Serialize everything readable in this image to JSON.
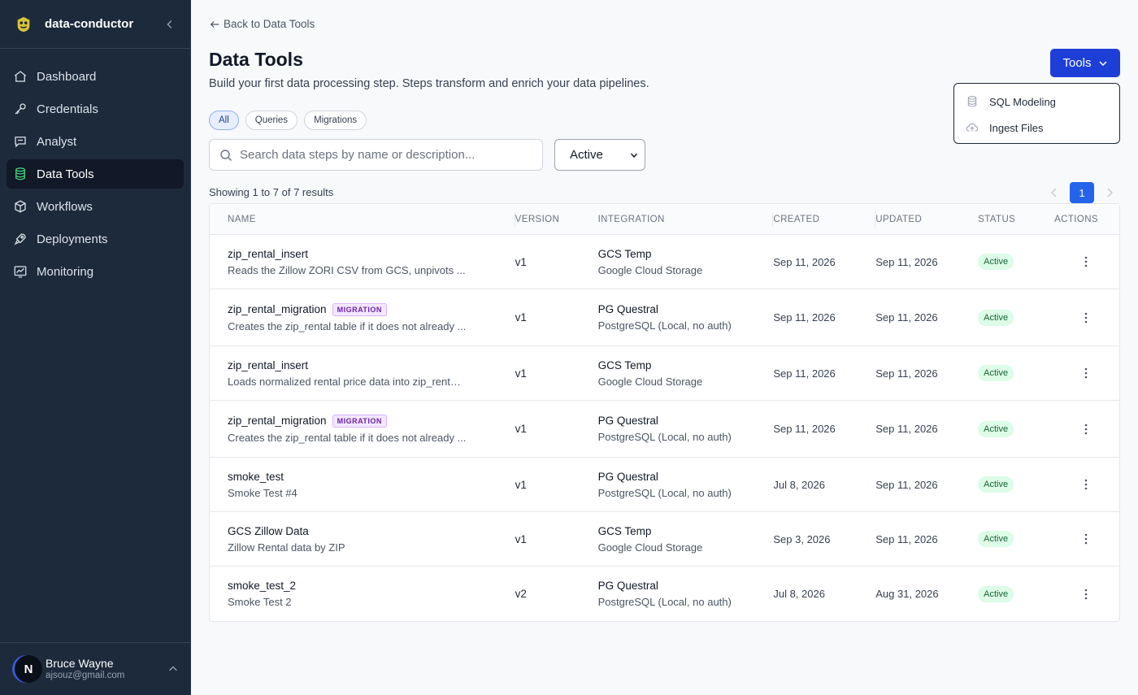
{
  "brand": {
    "name": "data-conductor"
  },
  "nav": [
    {
      "label": "Dashboard",
      "icon": "home-icon"
    },
    {
      "label": "Credentials",
      "icon": "key-icon"
    },
    {
      "label": "Analyst",
      "icon": "chat-icon"
    },
    {
      "label": "Data Tools",
      "icon": "database-icon",
      "active": true
    },
    {
      "label": "Workflows",
      "icon": "cube-icon"
    },
    {
      "label": "Deployments",
      "icon": "rocket-icon"
    },
    {
      "label": "Monitoring",
      "icon": "chart-icon"
    }
  ],
  "user": {
    "initial": "N",
    "name": "Bruce Wayne",
    "email": "ajsouz@gmail.com"
  },
  "page": {
    "back_label": "Back to Data Tools",
    "title": "Data Tools",
    "subtitle": "Build your first data processing step. Steps transform and enrich your data pipelines."
  },
  "tools": {
    "label": "Tools",
    "menu": [
      {
        "label": "SQL Modeling",
        "icon": "database-icon"
      },
      {
        "label": "Ingest Files",
        "icon": "cloud-upload-icon"
      }
    ]
  },
  "filters": {
    "chips": [
      {
        "label": "All",
        "active": true
      },
      {
        "label": "Queries",
        "active": false
      },
      {
        "label": "Migrations",
        "active": false
      }
    ],
    "search_placeholder": "Search data steps by name or description...",
    "status_value": "Active"
  },
  "results_text": "Showing 1 to 7 of 7 results",
  "pagination": {
    "current": "1"
  },
  "table": {
    "columns": [
      "NAME",
      "VERSION",
      "INTEGRATION",
      "CREATED",
      "UPDATED",
      "STATUS",
      "ACTIONS"
    ],
    "rows": [
      {
        "name": "zip_rental_insert",
        "badge": "",
        "desc": "Reads the Zillow ZORI CSV from GCS, unpivots ...",
        "version": "v1",
        "integration": "GCS Temp",
        "integration_sub": "Google Cloud Storage",
        "created": "Sep 11, 2026",
        "updated": "Sep 11, 2026",
        "status": "Active"
      },
      {
        "name": "zip_rental_migration",
        "badge": "MIGRATION",
        "desc": "Creates the zip_rental table if it does not already ...",
        "version": "v1",
        "integration": "PG Questral",
        "integration_sub": "PostgreSQL (Local, no auth)",
        "created": "Sep 11, 2026",
        "updated": "Sep 11, 2026",
        "status": "Active"
      },
      {
        "name": "zip_rental_insert",
        "badge": "",
        "desc": "Loads normalized rental price data into zip_rental...",
        "version": "v1",
        "integration": "GCS Temp",
        "integration_sub": "Google Cloud Storage",
        "created": "Sep 11, 2026",
        "updated": "Sep 11, 2026",
        "status": "Active"
      },
      {
        "name": "zip_rental_migration",
        "badge": "MIGRATION",
        "desc": "Creates the zip_rental table if it does not already ...",
        "version": "v1",
        "integration": "PG Questral",
        "integration_sub": "PostgreSQL (Local, no auth)",
        "created": "Sep 11, 2026",
        "updated": "Sep 11, 2026",
        "status": "Active"
      },
      {
        "name": "smoke_test",
        "badge": "",
        "desc": "Smoke Test #4",
        "version": "v1",
        "integration": "PG Questral",
        "integration_sub": "PostgreSQL (Local, no auth)",
        "created": "Jul 8, 2026",
        "updated": "Sep 11, 2026",
        "status": "Active"
      },
      {
        "name": "GCS Zillow Data",
        "badge": "",
        "desc": "Zillow Rental data by ZIP",
        "version": "v1",
        "integration": "GCS Temp",
        "integration_sub": "Google Cloud Storage",
        "created": "Sep 3, 2026",
        "updated": "Sep 11, 2026",
        "status": "Active"
      },
      {
        "name": "smoke_test_2",
        "badge": "",
        "desc": "Smoke Test 2",
        "version": "v2",
        "integration": "PG Questral",
        "integration_sub": "PostgreSQL (Local, no auth)",
        "created": "Jul 8, 2026",
        "updated": "Aug 31, 2026",
        "status": "Active"
      }
    ]
  }
}
